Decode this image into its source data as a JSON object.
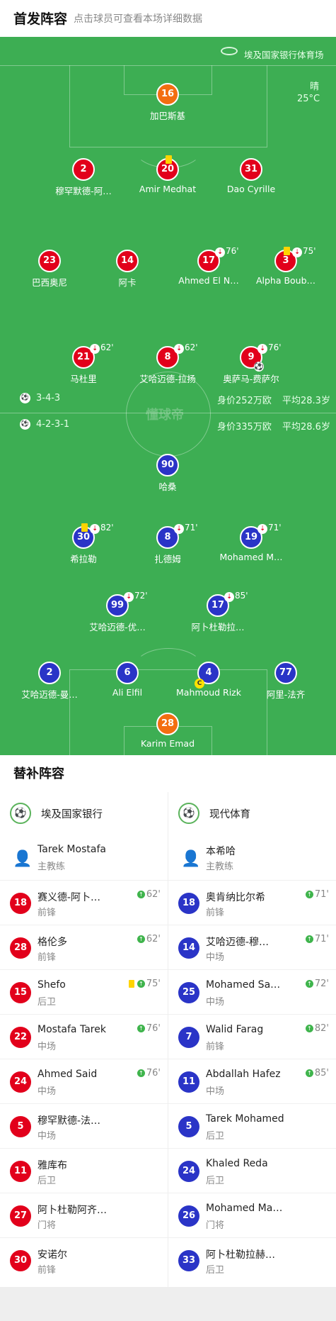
{
  "header": {
    "title": "首发阵容",
    "subtitle": "点击球员可查看本场详细数据"
  },
  "venue": "埃及国家银行体育场",
  "weather": {
    "condition": "晴",
    "temp": "25°C"
  },
  "brand_watermark": "懂球帝",
  "home": {
    "formation": "3-4-3",
    "value": "身价252万欧",
    "age": "平均28.3岁",
    "color": "#e2001b",
    "players": [
      {
        "num": "16",
        "name": "加巴斯基",
        "gk": true
      },
      {
        "num": "2",
        "name": "穆罕默德-阿…"
      },
      {
        "num": "20",
        "name": "Amir Medhat",
        "yellow": true
      },
      {
        "num": "31",
        "name": "Dao Cyrille"
      },
      {
        "num": "23",
        "name": "巴西奥尼"
      },
      {
        "num": "14",
        "name": "阿卡"
      },
      {
        "num": "17",
        "name": "Ahmed El N…",
        "sub": "76'"
      },
      {
        "num": "3",
        "name": "Alpha Boub…",
        "sub": "75'",
        "yellow": true
      },
      {
        "num": "21",
        "name": "马杜里",
        "sub": "62'"
      },
      {
        "num": "8",
        "name": "艾哈迈德-拉扬",
        "sub": "62'"
      },
      {
        "num": "9",
        "name": "奥萨马-费萨尔",
        "sub": "76'",
        "goal": true
      }
    ]
  },
  "away": {
    "formation": "4-2-3-1",
    "value": "身价335万欧",
    "age": "平均28.6岁",
    "color": "#2a34c7",
    "players": [
      {
        "num": "90",
        "name": "哈桑"
      },
      {
        "num": "30",
        "name": "希拉勒",
        "sub": "82'",
        "yellow": true
      },
      {
        "num": "8",
        "name": "扎德姆",
        "sub": "71'"
      },
      {
        "num": "19",
        "name": "Mohamed M…",
        "sub": "71'"
      },
      {
        "num": "99",
        "name": "艾哈迈德-优…",
        "sub": "72'"
      },
      {
        "num": "17",
        "name": "阿卜杜勒拉…",
        "sub": "85'"
      },
      {
        "num": "2",
        "name": "艾哈迈德-曼…"
      },
      {
        "num": "6",
        "name": "Ali Elfil"
      },
      {
        "num": "4",
        "name": "Mahmoud Rizk",
        "captain": true
      },
      {
        "num": "77",
        "name": "阿里-法齐"
      },
      {
        "num": "28",
        "name": "Karim Emad",
        "gk": true
      }
    ]
  },
  "captain_mark": "C",
  "subs": {
    "title": "替补阵容",
    "home": {
      "team": "埃及国家银行",
      "coach": {
        "name": "Tarek Mostafa",
        "role": "主教练"
      },
      "list": [
        {
          "num": "18",
          "name": "赛义德-阿卜…",
          "pos": "前锋",
          "ev": "62'"
        },
        {
          "num": "28",
          "name": "格伦多",
          "pos": "前锋",
          "ev": "62'"
        },
        {
          "num": "15",
          "name": "Shefo",
          "pos": "后卫",
          "ev": "75'",
          "yellow": true
        },
        {
          "num": "22",
          "name": "Mostafa Tarek",
          "pos": "中场",
          "ev": "76'"
        },
        {
          "num": "24",
          "name": "Ahmed Said",
          "pos": "中场",
          "ev": "76'"
        },
        {
          "num": "5",
          "name": "穆罕默德-法…",
          "pos": "中场"
        },
        {
          "num": "11",
          "name": "雅库布",
          "pos": "后卫"
        },
        {
          "num": "27",
          "name": "阿卜杜勒阿齐…",
          "pos": "门将"
        },
        {
          "num": "30",
          "name": "安诺尔",
          "pos": "前锋"
        }
      ]
    },
    "away": {
      "team": "现代体育",
      "coach": {
        "name": "本希哈",
        "role": "主教练"
      },
      "list": [
        {
          "num": "18",
          "name": "奥肯纳比尔希",
          "pos": "前锋",
          "ev": "71'"
        },
        {
          "num": "14",
          "name": "艾哈迈德-穆…",
          "pos": "中场",
          "ev": "71'"
        },
        {
          "num": "25",
          "name": "Mohamed Sa…",
          "pos": "中场",
          "ev": "72'"
        },
        {
          "num": "7",
          "name": "Walid Farag",
          "pos": "前锋",
          "ev": "82'"
        },
        {
          "num": "11",
          "name": "Abdallah Hafez",
          "pos": "中场",
          "ev": "85'"
        },
        {
          "num": "5",
          "name": "Tarek Mohamed",
          "pos": "后卫"
        },
        {
          "num": "24",
          "name": "Khaled Reda",
          "pos": "后卫"
        },
        {
          "num": "26",
          "name": "Mohamed Ma…",
          "pos": "门将"
        },
        {
          "num": "33",
          "name": "阿卜杜勒拉赫…",
          "pos": "后卫"
        }
      ]
    }
  }
}
